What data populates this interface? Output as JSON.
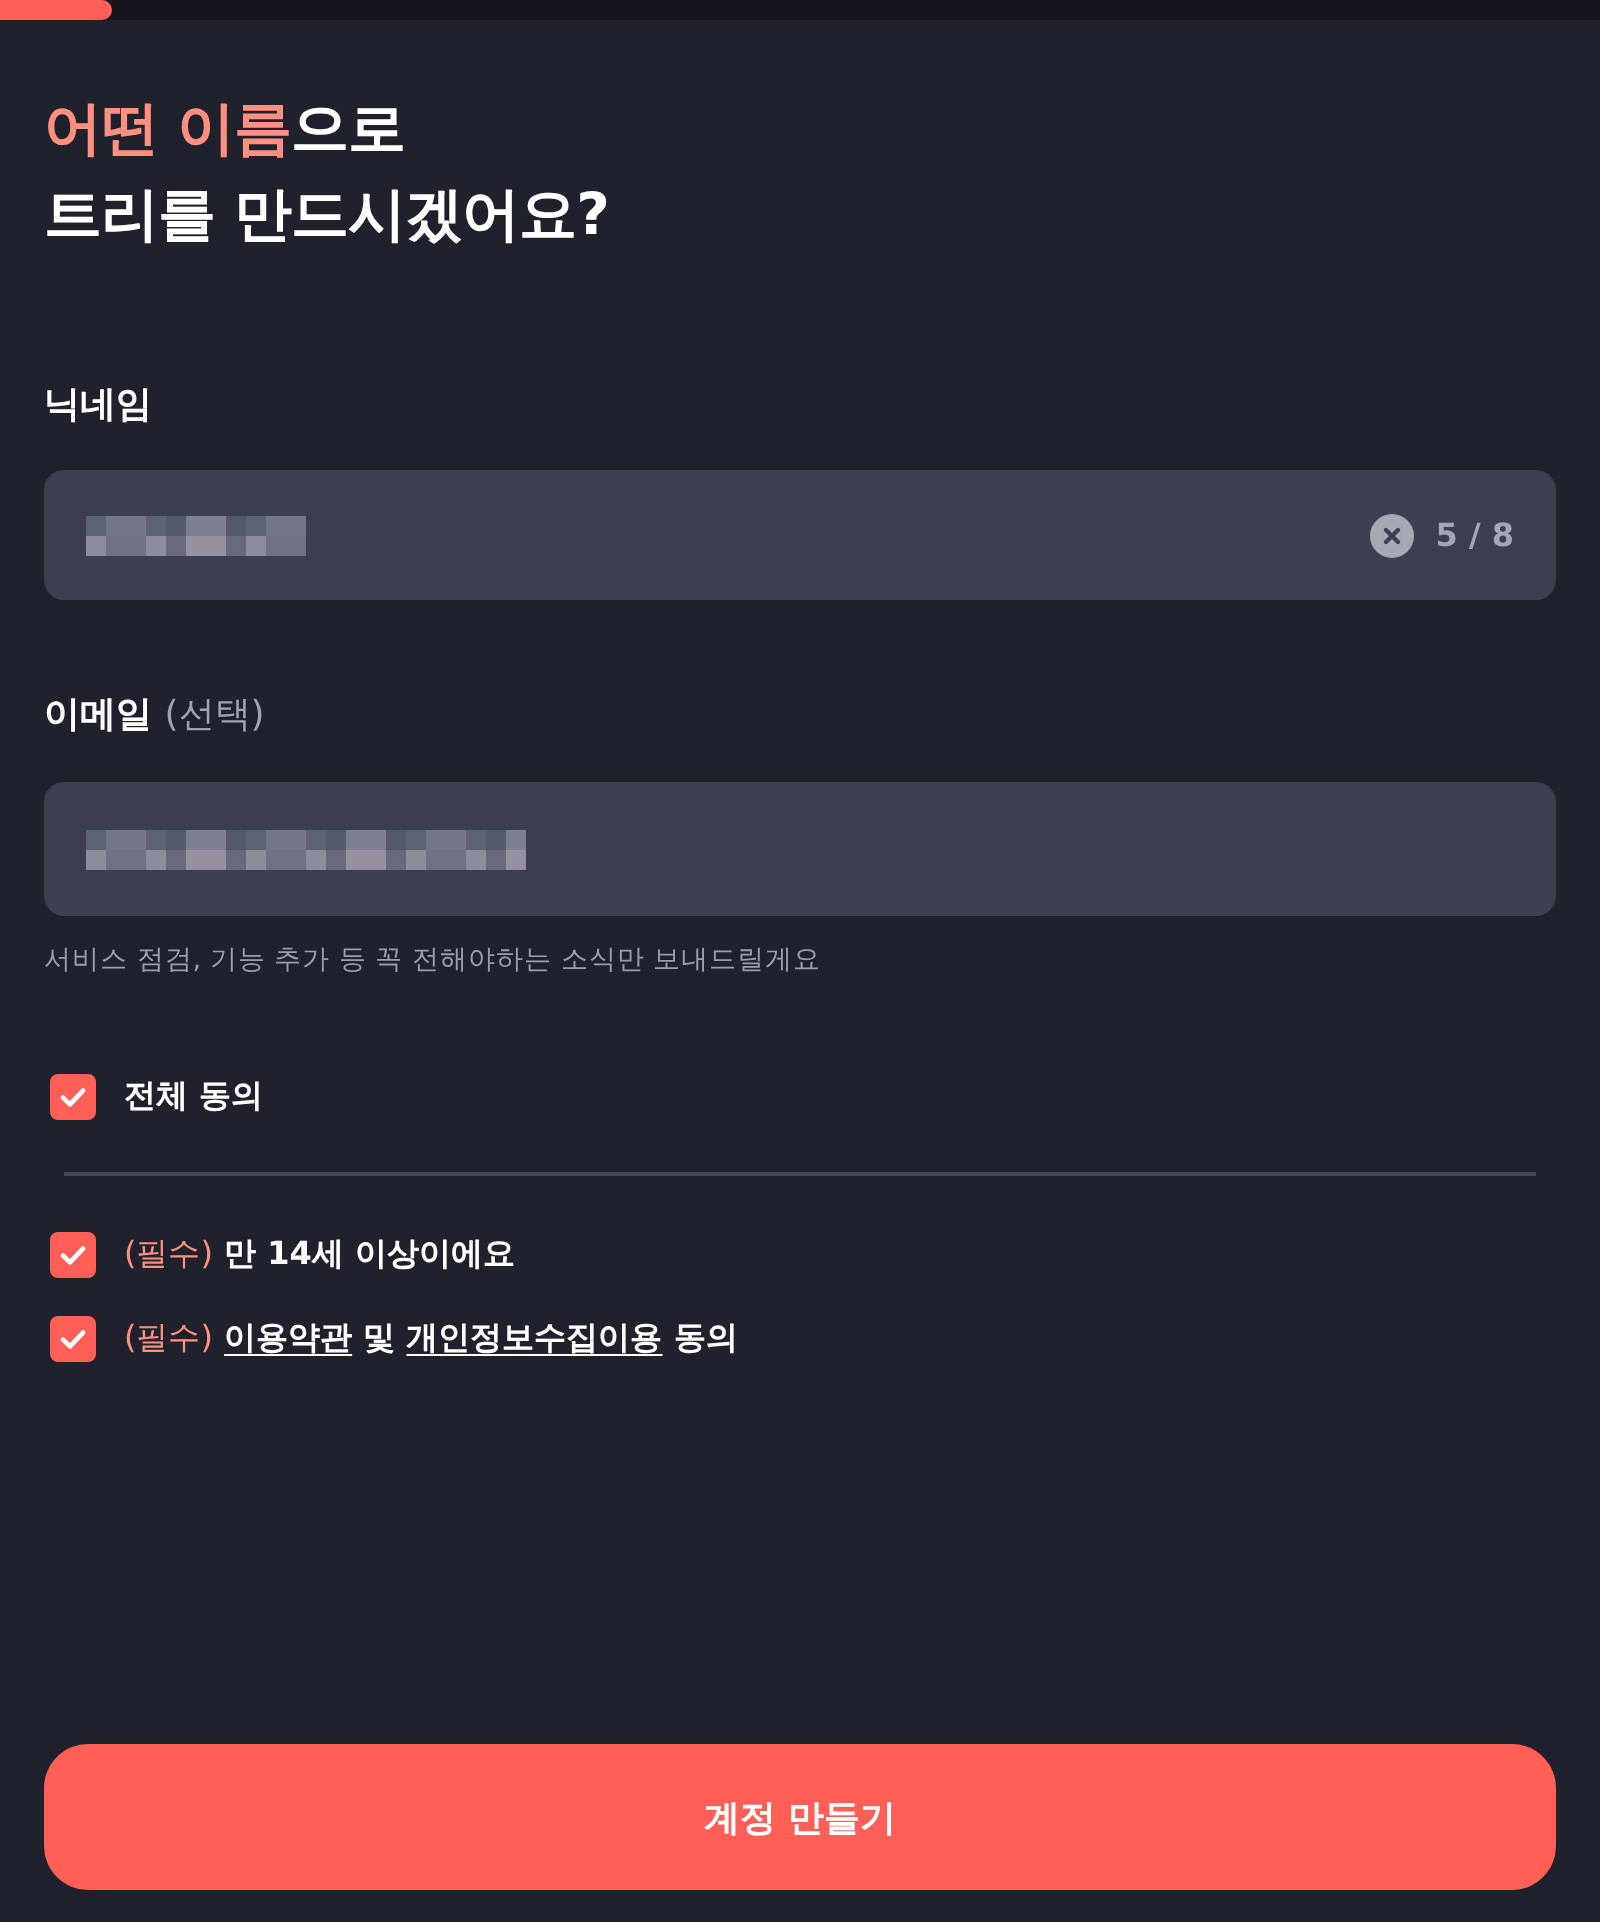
{
  "progress": {
    "level": 0.07
  },
  "heading": {
    "lines": [
      [
        {
          "text": "어떤 이름",
          "highlight": true
        },
        {
          "text": "으로",
          "highlight": false
        }
      ],
      [
        {
          "text": "트리를 만드시겠어요?",
          "highlight": false
        }
      ]
    ]
  },
  "nickname": {
    "label": "닉네임",
    "value_obscured": true,
    "clearable": true,
    "counter": "5 / 8"
  },
  "email": {
    "label": "이메일",
    "label_note": "(선택)",
    "value_obscured": true,
    "clearable": false,
    "helper": "서비스 점검, 기능 추가 등 꼭 전해야하는 소식만 보내드릴게요"
  },
  "agreements": {
    "all": {
      "label": "전체 동의",
      "checked": true
    },
    "items": [
      {
        "checked": true,
        "parts": [
          {
            "kind": "tag",
            "text": "(필수)"
          },
          {
            "kind": "text",
            "text": "만 14세 이상이에요"
          }
        ]
      },
      {
        "checked": true,
        "parts": [
          {
            "kind": "tag",
            "text": "(필수)"
          },
          {
            "kind": "link",
            "text": "이용약관"
          },
          {
            "kind": "text",
            "text": "및"
          },
          {
            "kind": "link",
            "text": "개인정보수집이용"
          },
          {
            "kind": "text",
            "text": "동의"
          }
        ]
      }
    ]
  },
  "submit": {
    "label": "계정 만들기"
  }
}
